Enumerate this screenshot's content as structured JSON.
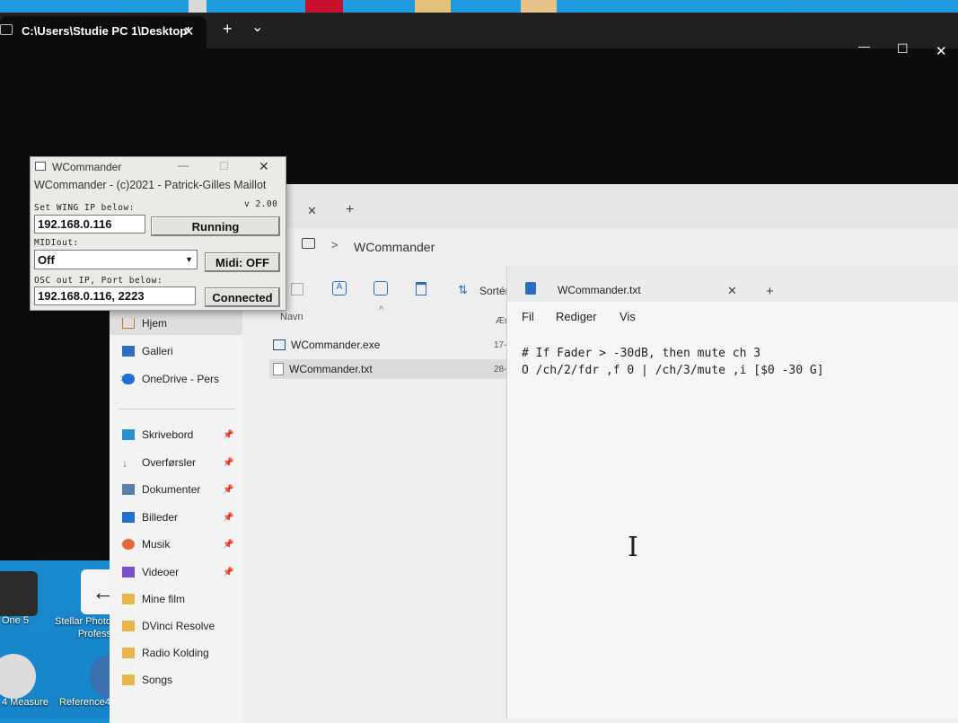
{
  "terminal": {
    "tab_title": "C:\\Users\\Studie PC 1\\Desktop'",
    "new_tab": "+",
    "dropdown": "⌄",
    "win_min": "—",
    "win_max": "☐",
    "win_close": "✕",
    "tab_close": "✕"
  },
  "desktop": {
    "icons": [
      {
        "label": "One 5"
      },
      {
        "label": "Stellar Photo Profess"
      },
      {
        "label": "4 Measure"
      },
      {
        "label": "Reference4"
      }
    ]
  },
  "wcommander": {
    "title": "WCommander",
    "header": "WCommander - (c)2021 - Patrick-Gilles Maillot",
    "version": "v 2.00",
    "wing_ip_label": "Set WING IP below:",
    "wing_ip_value": "192.168.0.116",
    "running_button": "Running",
    "midi_out_label": "MIDIout:",
    "midi_out_value": "Off",
    "midi_button": "Midi: OFF",
    "osc_label": "OSC out IP, Port below:",
    "osc_value": "192.168.0.116, 2223",
    "connected_button": "Connected",
    "min": "—",
    "max": "☐",
    "close": "✕"
  },
  "explorer": {
    "tab_close": "✕",
    "new_tab": "+",
    "breadcrumb_sep": ">",
    "breadcrumb": "WCommander",
    "sort_label": "Sortér",
    "col_name": "Navn",
    "col_changed": "Æn",
    "files": [
      {
        "name": "WCommander.exe",
        "date": "17-"
      },
      {
        "name": "WCommander.txt",
        "date": "28-"
      }
    ],
    "sidebar": [
      {
        "label": "Hjem",
        "pinned": false
      },
      {
        "label": "Galleri",
        "pinned": false
      },
      {
        "label": "OneDrive - Pers",
        "pinned": false
      },
      {
        "label": "Skrivebord",
        "pinned": true
      },
      {
        "label": "Overførsler",
        "pinned": true
      },
      {
        "label": "Dokumenter",
        "pinned": true
      },
      {
        "label": "Billeder",
        "pinned": true
      },
      {
        "label": "Musik",
        "pinned": true
      },
      {
        "label": "Videoer",
        "pinned": true
      },
      {
        "label": "Mine film",
        "pinned": false
      },
      {
        "label": "DVinci Resolve",
        "pinned": false
      },
      {
        "label": "Radio Kolding",
        "pinned": false
      },
      {
        "label": "Songs",
        "pinned": false
      }
    ],
    "expand_arrow": ">"
  },
  "notepad": {
    "tab_title": "WCommander.txt",
    "tab_close": "✕",
    "new_tab": "+",
    "menu": [
      "Fil",
      "Rediger",
      "Vis"
    ],
    "lines": [
      "# If Fader > -30dB, then mute ch 3",
      "O /ch/2/fdr ,f 0 | /ch/3/mute ,i [$0 -30 G]"
    ]
  }
}
